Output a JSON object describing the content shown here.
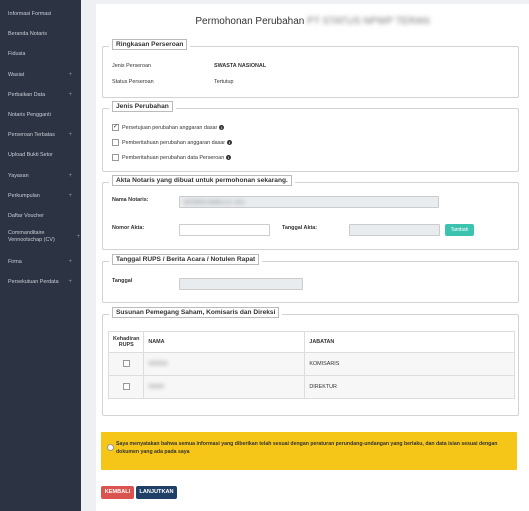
{
  "sidebar": {
    "items": [
      {
        "label": "Informasi Formasi",
        "plus": ""
      },
      {
        "label": "Beranda Notaris",
        "plus": ""
      },
      {
        "label": "Fidusia",
        "plus": ""
      },
      {
        "label": "Wasiat",
        "plus": "+"
      },
      {
        "label": "Perbaikan Data",
        "plus": "+"
      },
      {
        "label": "Notaris Pengganti",
        "plus": ""
      },
      {
        "label": "Perseroan Terbatas",
        "plus": "+"
      },
      {
        "label": "Upload Bukti Setor",
        "plus": ""
      },
      {
        "label": "Yayasan",
        "plus": "+"
      },
      {
        "label": "Perkumpulan",
        "plus": "+"
      },
      {
        "label": "Daftar Voucher",
        "plus": ""
      },
      {
        "label": "Commanditaire Vennootschap (CV)",
        "plus": "+"
      },
      {
        "label": "Firma",
        "plus": "+"
      },
      {
        "label": "Persekutuan Perdata",
        "plus": "+"
      }
    ]
  },
  "page": {
    "title": "Permohonan Perubahan",
    "title_blurred": "PT STATUS NPWP TERAN"
  },
  "ringkasan": {
    "legend": "Ringkasan Perseroan",
    "jenis_label": "Jenis Perseroan",
    "jenis_value": "SWASTA NASIONAL",
    "status_label": "Status Perseroan",
    "status_value": "Tertutup"
  },
  "jenis_perubahan": {
    "legend": "Jenis Perubahan",
    "options": [
      {
        "label": "Persetujuan perubahan anggaran dasar",
        "checked": true
      },
      {
        "label": "Pemberitahuan perubahan anggaran dasar",
        "checked": false
      },
      {
        "label": "Pemberitahuan perubahan data Perseroan",
        "checked": false
      }
    ]
  },
  "akta": {
    "legend": "Akta Notaris yang dibuat untuk permohonan sekarang.",
    "nama_label": "Nama Notaris:",
    "nama_value_blurred": "NOTARIS NAMA S.H., M.K.",
    "nomor_label": "Nomor Akta:",
    "nomor_value": "",
    "tanggal_label": "Tanggal Akta:",
    "tanggal_value": "",
    "tambah_label": "Tambah"
  },
  "rups": {
    "legend": "Tanggal RUPS / Berita Acara / Notulen Rapat",
    "tanggal_label": "Tanggal",
    "tanggal_value": ""
  },
  "susunan": {
    "legend": "Susunan Pemegang Saham, Komisaris dan Direksi",
    "headers": [
      "Kehadiran RUPS",
      "NAMA",
      "JABATAN"
    ],
    "rows": [
      {
        "nama_blurred": "NAMAA",
        "jabatan": "KOMISARIS"
      },
      {
        "nama_blurred": "NAMA",
        "jabatan": "DIREKTUR"
      }
    ]
  },
  "notice": {
    "text": "Saya menyatakan bahwa semua informasi yang diberikan telah sesuai dengan peraturan perundang-undangan yang berlaku, dan data isian sesuai dengan dokumen yang ada pada saya"
  },
  "buttons": {
    "kembali": "KEMBALI",
    "lanjutkan": "LANJUTKAN"
  },
  "colors": {
    "sidebar": "#2c3443",
    "notice": "#f5c518",
    "kembali": "#d9534f",
    "lanjutkan": "#1f3f66",
    "tambah": "#3cc3b0"
  }
}
